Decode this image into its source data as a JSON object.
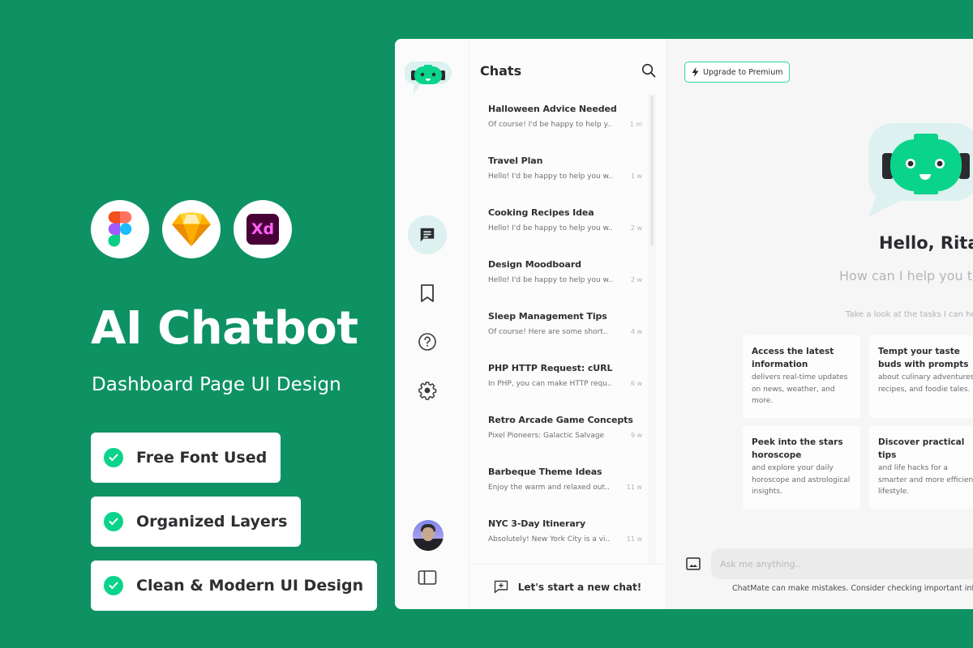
{
  "promo": {
    "tools": [
      {
        "name": "figma",
        "icon": "figma-logo"
      },
      {
        "name": "sketch",
        "icon": "sketch-logo"
      },
      {
        "name": "adobe-xd",
        "icon": "xd-logo",
        "text": "Xd"
      }
    ],
    "title": "AI Chatbot",
    "subtitle": "Dashboard Page UI Design",
    "features": [
      {
        "label": "Free Font Used",
        "icon": "check-circle-icon"
      },
      {
        "label": "Organized Layers",
        "icon": "check-circle-icon"
      },
      {
        "label": "Clean & Modern UI Design",
        "icon": "check-circle-icon"
      }
    ]
  },
  "sidebar": {
    "logo": "robot-logo",
    "items": [
      {
        "name": "chats",
        "icon": "chat-icon",
        "active": true
      },
      {
        "name": "saved",
        "icon": "bookmark-icon",
        "active": false
      },
      {
        "name": "help",
        "icon": "help-icon",
        "active": false
      },
      {
        "name": "settings",
        "icon": "gear-icon",
        "active": false
      }
    ],
    "bottom": [
      {
        "name": "profile",
        "icon": "avatar"
      },
      {
        "name": "toggle-panel",
        "icon": "sidebar-toggle-icon"
      }
    ]
  },
  "chatlist": {
    "title": "Chats",
    "search_icon": "search-icon",
    "items": [
      {
        "title": "Halloween Advice Needed",
        "preview": "Of course! I'd be happy to help y..",
        "time": "1 m"
      },
      {
        "title": "Travel Plan",
        "preview": "Hello! I'd be happy to help you w..",
        "time": "1 w"
      },
      {
        "title": "Cooking Recipes Idea",
        "preview": "Hello! I'd be happy to help you w..",
        "time": "2 w"
      },
      {
        "title": "Design Moodboard",
        "preview": "Hello! I'd be happy to help you w..",
        "time": "2 w"
      },
      {
        "title": "Sleep Management Tips",
        "preview": "Of course! Here are some short..",
        "time": "4 w"
      },
      {
        "title": "PHP HTTP Request: cURL",
        "preview": "In PHP, you can make HTTP requ..",
        "time": "6 w"
      },
      {
        "title": "Retro Arcade Game Concepts",
        "preview": "Pixel Pioneers: Galactic Salvage",
        "time": "9 w"
      },
      {
        "title": "Barbeque Theme Ideas",
        "preview": "Enjoy the warm and relaxed out..",
        "time": "11 w"
      },
      {
        "title": "NYC 3-Day Itinerary",
        "preview": "Absolutely! New York City is a vi..",
        "time": "11 w"
      }
    ],
    "new_chat_label": "Let's start a new chat!"
  },
  "main": {
    "upgrade_label": "Upgrade to Premium",
    "greeting": "Hello, Rita!",
    "help_text": "How can I help you today?",
    "tasks_text": "Take a look at the tasks I can help you with",
    "cards": [
      {
        "title": "Access the latest information",
        "desc": "delivers real-time updates on news, weather, and more."
      },
      {
        "title": "Tempt your taste buds with prompts",
        "desc": "about culinary adventures, recipes, and foodie tales."
      },
      {
        "title": "Peek into the stars horoscope",
        "desc": "and explore your daily horoscope and astrological insights."
      },
      {
        "title": "Discover practical tips",
        "desc": "and life hacks for a smarter and more efficient lifestyle."
      }
    ],
    "input_placeholder": "Ask me anything..",
    "input_value": "",
    "disclaimer": "ChatMate can make mistakes. Consider checking important information."
  },
  "colors": {
    "background": "#0e9263",
    "accent": "#0ad48b",
    "active_nav": "#dcf1f0",
    "text_dark": "#2f2f33"
  }
}
